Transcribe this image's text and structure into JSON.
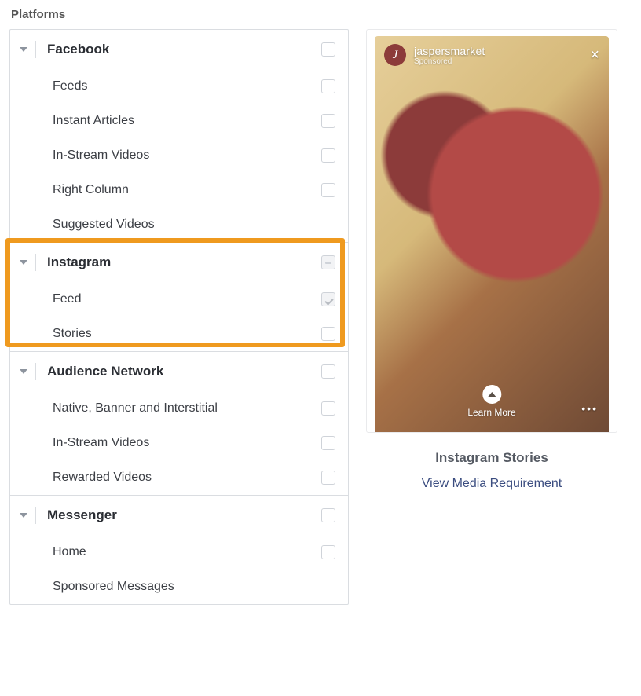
{
  "section_label": "Platforms",
  "groups": [
    {
      "key": "facebook",
      "title": "Facebook",
      "state": "unchecked",
      "children": [
        {
          "label": "Feeds",
          "state": "unchecked"
        },
        {
          "label": "Instant Articles",
          "state": "unchecked"
        },
        {
          "label": "In-Stream Videos",
          "state": "unchecked"
        },
        {
          "label": "Right Column",
          "state": "unchecked"
        },
        {
          "label": "Suggested Videos",
          "state": "none"
        }
      ]
    },
    {
      "key": "instagram",
      "title": "Instagram",
      "state": "indeterminate",
      "children": [
        {
          "label": "Feed",
          "state": "checked"
        },
        {
          "label": "Stories",
          "state": "unchecked"
        }
      ]
    },
    {
      "key": "audience-network",
      "title": "Audience Network",
      "state": "unchecked",
      "children": [
        {
          "label": "Native, Banner and Interstitial",
          "state": "unchecked"
        },
        {
          "label": "In-Stream Videos",
          "state": "unchecked"
        },
        {
          "label": "Rewarded Videos",
          "state": "unchecked"
        }
      ]
    },
    {
      "key": "messenger",
      "title": "Messenger",
      "state": "unchecked",
      "children": [
        {
          "label": "Home",
          "state": "unchecked"
        },
        {
          "label": "Sponsored Messages",
          "state": "none"
        }
      ]
    }
  ],
  "highlight_group": "instagram",
  "highlight_color": "#ef9a1f",
  "preview": {
    "brand_initial": "J",
    "brand_name": "jaspersmarket",
    "sponsored_label": "Sponsored",
    "cta": "Learn More",
    "title": "Instagram Stories",
    "link": "View Media Requirement"
  }
}
